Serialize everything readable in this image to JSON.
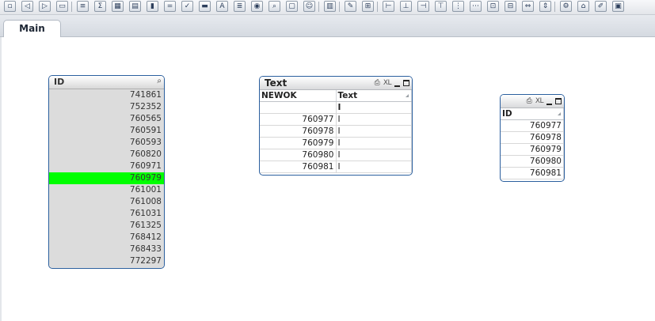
{
  "toolbar": {
    "buttons": [
      {
        "icon": "new-document-icon",
        "glyph": "▫"
      },
      {
        "icon": "back-icon",
        "glyph": "◁"
      },
      {
        "icon": "forward-icon",
        "glyph": "▷"
      },
      {
        "icon": "open-folder-icon",
        "glyph": "▭"
      },
      {
        "icon": "list-box-icon",
        "glyph": "≡"
      },
      {
        "icon": "statistics-box-icon",
        "glyph": "Σ"
      },
      {
        "icon": "table-box-icon",
        "glyph": "▦"
      },
      {
        "icon": "multi-box-icon",
        "glyph": "▤"
      },
      {
        "icon": "chart-icon",
        "glyph": "▮"
      },
      {
        "icon": "input-box-icon",
        "glyph": "="
      },
      {
        "icon": "current-selections-icon",
        "glyph": "✓"
      },
      {
        "icon": "button-icon",
        "glyph": "▬"
      },
      {
        "icon": "text-object-icon",
        "glyph": "A"
      },
      {
        "icon": "line-object-icon",
        "glyph": "≣"
      },
      {
        "icon": "slider-icon",
        "glyph": "◉"
      },
      {
        "icon": "search-object-icon",
        "glyph": "⌕"
      },
      {
        "icon": "bookmark-icon",
        "glyph": "▢"
      },
      {
        "icon": "container-icon",
        "glyph": "☺"
      },
      {
        "icon": "reload-chart-icon",
        "glyph": "▥"
      },
      {
        "icon": "format-painter-icon",
        "glyph": "✎"
      },
      {
        "icon": "align-icon",
        "glyph": "⊞"
      },
      {
        "icon": "align-left-icon",
        "glyph": "⊢"
      },
      {
        "icon": "align-center-icon",
        "glyph": "⊥"
      },
      {
        "icon": "align-right-icon",
        "glyph": "⊣"
      },
      {
        "icon": "align-top-icon",
        "glyph": "⊤"
      },
      {
        "icon": "distribute-h-icon",
        "glyph": "⋮"
      },
      {
        "icon": "distribute-v-icon",
        "glyph": "⋯"
      },
      {
        "icon": "spacing-icon",
        "glyph": "⊡"
      },
      {
        "icon": "resize-icon",
        "glyph": "⊟"
      },
      {
        "icon": "move-icon",
        "glyph": "⇔"
      },
      {
        "icon": "order-icon",
        "glyph": "⇕"
      },
      {
        "icon": "properties-icon",
        "glyph": "⚙"
      },
      {
        "icon": "lock-icon",
        "glyph": "⌂"
      },
      {
        "icon": "edit-icon",
        "glyph": "✐"
      },
      {
        "icon": "edit-script-icon",
        "glyph": "▣"
      }
    ]
  },
  "tabs": [
    {
      "label": "Main"
    }
  ],
  "listbox": {
    "title": "ID",
    "search_icon": "search-icon",
    "items": [
      {
        "value": "741861",
        "selected": false
      },
      {
        "value": "752352",
        "selected": false
      },
      {
        "value": "760565",
        "selected": false
      },
      {
        "value": "760591",
        "selected": false
      },
      {
        "value": "760593",
        "selected": false
      },
      {
        "value": "760820",
        "selected": false
      },
      {
        "value": "760971",
        "selected": false
      },
      {
        "value": "760979",
        "selected": true
      },
      {
        "value": "761001",
        "selected": false
      },
      {
        "value": "761008",
        "selected": false
      },
      {
        "value": "761031",
        "selected": false
      },
      {
        "value": "761325",
        "selected": false
      },
      {
        "value": "768412",
        "selected": false
      },
      {
        "value": "768433",
        "selected": false
      },
      {
        "value": "772297",
        "selected": false
      }
    ],
    "selected_color": "#00ff00"
  },
  "text_table": {
    "title": "Text",
    "xl_label": "XL",
    "columns": [
      "NEWOK",
      "Text"
    ],
    "header_text_value": "I",
    "rows": [
      [
        "760977",
        "I"
      ],
      [
        "760978",
        "I"
      ],
      [
        "760979",
        "I"
      ],
      [
        "760980",
        "I"
      ],
      [
        "760981",
        "I"
      ]
    ]
  },
  "id_table": {
    "xl_label": "XL",
    "columns": [
      "ID"
    ],
    "rows": [
      [
        "760977"
      ],
      [
        "760978"
      ],
      [
        "760979"
      ],
      [
        "760980"
      ],
      [
        "760981"
      ]
    ]
  },
  "colors": {
    "border_accent": "#2b5f9e",
    "list_bg": "#dcdcdc"
  }
}
